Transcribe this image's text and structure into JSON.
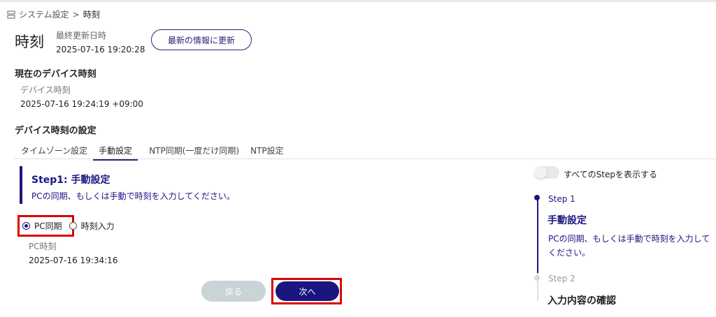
{
  "breadcrumb": {
    "parent": "システム設定",
    "separator": ">",
    "current": "時刻"
  },
  "page": {
    "title": "時刻",
    "last_updated_label": "最終更新日時",
    "last_updated_value": "2025-07-16 19:20:28",
    "refresh_button": "最新の情報に更新"
  },
  "device_time": {
    "heading": "現在のデバイス時刻",
    "label": "デバイス時刻",
    "value": "2025-07-16 19:24:19 +09:00"
  },
  "settings": {
    "heading": "デバイス時刻の設定",
    "tabs": [
      {
        "label": "タイムゾーン設定",
        "active": false
      },
      {
        "label": "手動設定",
        "active": true
      },
      {
        "label": "NTP同期(一度だけ同期)",
        "active": false
      },
      {
        "label": "NTP設定",
        "active": false
      }
    ]
  },
  "step_panel": {
    "title": "Step1: 手動設定",
    "description": "PCの同期、もしくは手動で時刻を入力してください。",
    "radio_options": [
      {
        "label": "PC同期",
        "selected": true
      },
      {
        "label": "時刻入力",
        "selected": false
      }
    ],
    "pc_time_label": "PC時刻",
    "pc_time_value": "2025-07-16 19:34:16",
    "back_button": "戻る",
    "next_button": "次へ"
  },
  "stepper": {
    "toggle_label": "すべてのStepを表示する",
    "toggle_on": false,
    "steps": [
      {
        "label": "Step 1",
        "title": "手動設定",
        "description": "PCの同期、もしくは手動で時刻を入力してください。",
        "active": true
      },
      {
        "label": "Step 2",
        "title": "入力内容の確認",
        "active": false
      }
    ]
  },
  "colors": {
    "accent": "#1b1580",
    "highlight": "#dd0000",
    "disabled_button": "#c9d4d7"
  }
}
